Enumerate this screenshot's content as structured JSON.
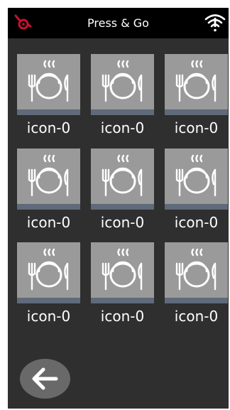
{
  "header": {
    "title": "Press & Go",
    "logo_icon": "brand-logo-icon",
    "status_icon": "wifi-warning-icon",
    "accent_color": "#c8102e"
  },
  "tiles": [
    {
      "label": "icon-0",
      "icon": "meal-plate-icon"
    },
    {
      "label": "icon-0",
      "icon": "meal-plate-icon"
    },
    {
      "label": "icon-0",
      "icon": "meal-plate-icon"
    },
    {
      "label": "icon-0",
      "icon": "meal-plate-icon"
    },
    {
      "label": "icon-0",
      "icon": "meal-plate-icon"
    },
    {
      "label": "icon-0",
      "icon": "meal-plate-icon"
    },
    {
      "label": "icon-0",
      "icon": "meal-plate-icon"
    },
    {
      "label": "icon-0",
      "icon": "meal-plate-icon"
    },
    {
      "label": "icon-0",
      "icon": "meal-plate-icon"
    }
  ],
  "footer": {
    "back_icon": "back-arrow-icon"
  }
}
